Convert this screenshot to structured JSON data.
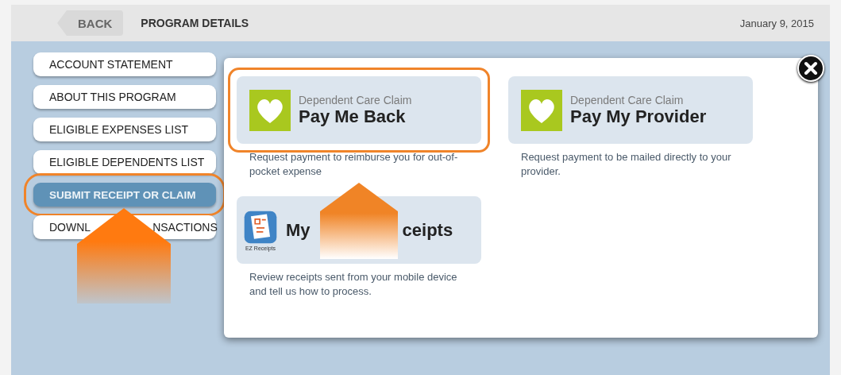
{
  "header": {
    "back": "BACK",
    "title": "PROGRAM DETAILS",
    "date": "January 9, 2015"
  },
  "sidebar": {
    "items": [
      {
        "parts": [
          "ACCOUNT STATEMENT"
        ],
        "selected": false,
        "highlighted": false
      },
      {
        "parts": [
          "ABOUT THIS PROGRAM"
        ],
        "selected": false,
        "highlighted": false
      },
      {
        "parts": [
          "ELIGIBLE EXPENSES LIST"
        ],
        "selected": false,
        "highlighted": false
      },
      {
        "parts": [
          "ELIGIBLE DEPENDENTS LIST"
        ],
        "selected": false,
        "highlighted": false
      },
      {
        "parts": [
          "SUBMIT RECEIPT OR CLAIM"
        ],
        "selected": true,
        "highlighted": true
      },
      {
        "parts": [
          "DOWNL",
          "NSACTIONS"
        ],
        "selected": false,
        "highlighted": false
      }
    ]
  },
  "dialog": {
    "cards": [
      {
        "kind": "heart",
        "subtitle": "Dependent Care Claim",
        "title_parts": [
          "Pay Me Back"
        ],
        "description": "Request payment to reimburse you for out-of-pocket expense",
        "highlighted": true
      },
      {
        "kind": "heart",
        "subtitle": "Dependent Care Claim",
        "title_parts": [
          "Pay My Provider"
        ],
        "description": "Request payment to be mailed directly to your provider.",
        "highlighted": false
      },
      {
        "kind": "receipts",
        "icon_label": "EZ Receipts",
        "title_parts": [
          "My",
          "ceipts"
        ],
        "description": "Review receipts sent from your mobile device and tell us how to process.",
        "highlighted": false
      }
    ]
  }
}
